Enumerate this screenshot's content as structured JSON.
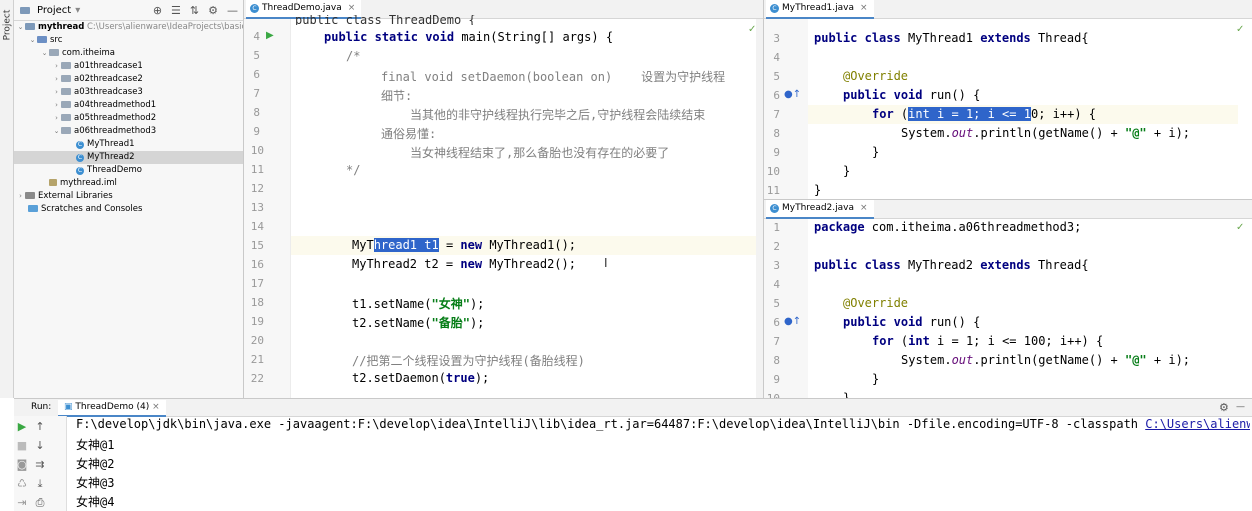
{
  "sidebar": {
    "stripe_label": "Project"
  },
  "project": {
    "title": "Project",
    "tree": [
      {
        "label": "mythread",
        "extra": "C:\\Users\\alienware\\IdeaProjects\\basic-"
      },
      {
        "label": "src"
      },
      {
        "label": "com.itheima"
      },
      {
        "label": "a01threadcase1"
      },
      {
        "label": "a02threadcase2"
      },
      {
        "label": "a03threadcase3"
      },
      {
        "label": "a04threadmethod1"
      },
      {
        "label": "a05threadmethod2"
      },
      {
        "label": "a06threadmethod3"
      },
      {
        "label": "MyThread1"
      },
      {
        "label": "MyThread2"
      },
      {
        "label": "ThreadDemo"
      },
      {
        "label": "mythread.iml"
      },
      {
        "label": "External Libraries"
      },
      {
        "label": "Scratches and Consoles"
      }
    ]
  },
  "editor_left": {
    "tab": "ThreadDemo.java",
    "partial_top": "public class ThreadDemo {",
    "lines": [
      {
        "n": "3",
        "t": ""
      },
      {
        "n": "4",
        "t": "public static void main(String[] args) {"
      },
      {
        "n": "5",
        "t": "/*"
      },
      {
        "n": "6",
        "t": "final void setDaemon(boolean on)    设置为守护线程"
      },
      {
        "n": "7",
        "t": "细节:"
      },
      {
        "n": "8",
        "t": "当其他的非守护线程执行完毕之后,守护线程会陆续结束"
      },
      {
        "n": "9",
        "t": "通俗易懂:"
      },
      {
        "n": "10",
        "t": "当女神线程结束了,那么备胎也没有存在的必要了"
      },
      {
        "n": "11",
        "t": "*/"
      },
      {
        "n": "12",
        "t": ""
      },
      {
        "n": "13",
        "t": ""
      },
      {
        "n": "14",
        "t": ""
      },
      {
        "n": "15",
        "t": "MyThread1 t1 = new MyThread1();"
      },
      {
        "n": "16",
        "t": "MyThread2 t2 = new MyThread2();"
      },
      {
        "n": "17",
        "t": ""
      },
      {
        "n": "18",
        "t": "t1.setName(\"女神\");"
      },
      {
        "n": "19",
        "t": "t2.setName(\"备胎\");"
      },
      {
        "n": "20",
        "t": ""
      },
      {
        "n": "21",
        "t": "//把第二个线程设置为守护线程(备胎线程)"
      },
      {
        "n": "22",
        "t": "t2.setDaemon(true);"
      }
    ],
    "tokens": {
      "public": "public",
      "static": "static",
      "void": "void",
      "main_sig": "main(String[] args) {",
      "c_open": "/*",
      "c_close": "*/",
      "c6": "final void setDaemon(boolean on)    设置为守护线程",
      "c7": "细节:",
      "c8": "当其他的非守护线程执行完毕之后,守护线程会陆续结束",
      "c9": "通俗易懂:",
      "c10": "当女神线程结束了,那么备胎也没有存在的必要了",
      "l15a": "MyT",
      "l15sel": "hread1 t1",
      "l15b": " = ",
      "new": "new",
      "l15c": " MyThread1();",
      "l16a": "MyThread2 t2 = ",
      "l16c": " MyThread2();",
      "l18a": "t1.setName(",
      "l18s": "\"女神\"",
      "l18b": ");",
      "l19a": "t2.setName(",
      "l19s": "\"备胎\"",
      "l19b": ");",
      "l21": "//把第二个线程设置为守护线程(备胎线程)",
      "l22a": "t2.setDaemon(",
      "true": "true",
      "l22b": ");"
    }
  },
  "editor_right_top": {
    "tab": "MyThread1.java",
    "lines": [
      "3",
      "4",
      "5",
      "6",
      "7",
      "8",
      "9",
      "10",
      "11"
    ],
    "t": {
      "public": "public",
      "class": "class",
      "name": " MyThread1 ",
      "extends": "extends",
      "thread": " Thread{",
      "override": "@Override",
      "void": "void",
      "run": " run() {",
      "for": "for",
      "sp": " (",
      "sel": "int i = 1; i <= 1",
      "rest": "0; i++) {",
      "sys": "System.",
      "out": "out",
      "println": ".println(getName() + ",
      "at": "\"@\"",
      "plus": " + i);",
      "close1": "}",
      "close2": "}",
      "close3": "}"
    }
  },
  "editor_right_bottom": {
    "tab": "MyThread2.java",
    "lines": [
      "1",
      "2",
      "3",
      "4",
      "5",
      "6",
      "7",
      "8",
      "9",
      "10"
    ],
    "t": {
      "package": "package",
      "pkg": " com.itheima.a06threadmethod3;",
      "public": "public",
      "class": "class",
      "name": " MyThread2 ",
      "extends": "extends",
      "thread": " Thread{",
      "override": "@Override",
      "void": "void",
      "run": " run() {",
      "for": "for",
      "sp": " (",
      "int": "int",
      "loop": " i = 1; i <= 100; i++) {",
      "sys": "System.",
      "out": "out",
      "println": ".println(getName() + ",
      "at": "\"@\"",
      "plus": " + i);",
      "close1": "}",
      "close2": "}"
    }
  },
  "run": {
    "label": "Run:",
    "tab": "ThreadDemo (4)",
    "cmd": "F:\\develop\\jdk\\bin\\java.exe -javaagent:F:\\develop\\idea\\IntelliJ\\lib\\idea_rt.jar=64487:F:\\develop\\idea\\IntelliJ\\bin -Dfile.encoding=UTF-8 -classpath ",
    "cmd_link": "C:\\Users\\alienwa",
    "output": [
      "女神@1",
      "女神@2",
      "女神@3",
      "女神@4"
    ]
  }
}
